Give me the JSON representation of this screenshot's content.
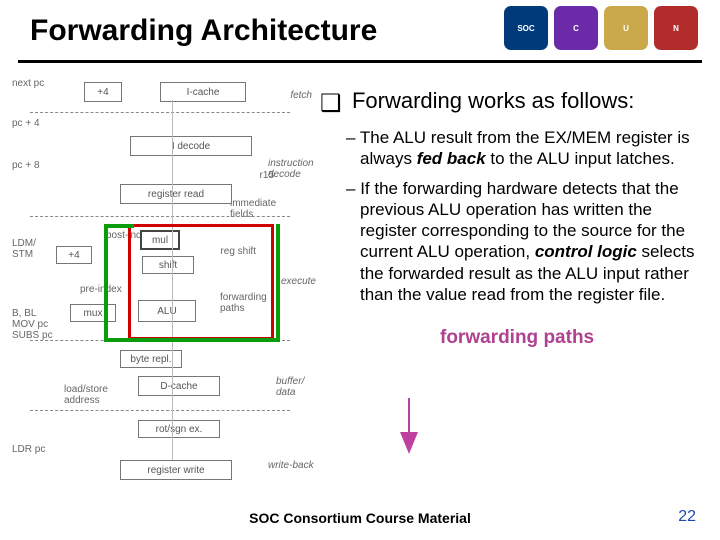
{
  "title": "Forwarding Architecture",
  "logos": [
    "SOC",
    "C",
    "U",
    "N"
  ],
  "lead": "Forwarding works as follows:",
  "bullets": [
    {
      "pre": "The ALU result from the EX/MEM register is always ",
      "em": "fed back",
      "post": " to the ALU input latches."
    },
    {
      "pre": "If the forwarding hardware detects that the previous ALU operation has written the register corresponding to the source for the current ALU operation, ",
      "em": "control logic",
      "post": " selects the forwarded result as the ALU input rather than the value read from the register file."
    }
  ],
  "fpaths_label": "forwarding paths",
  "footer": "SOC Consortium Course Material",
  "page": "22",
  "diag": {
    "fetch": "fetch",
    "decode": "instruction decode",
    "exec": "execute",
    "buf": "buffer/ data",
    "wb": "write-back",
    "next_pc": "next pc",
    "pc4": "pc + 4",
    "pc8": "pc + 8",
    "r15": "r15",
    "immed": "immediate fields",
    "plus4": "+4",
    "icache": "I-cache",
    "idec": "I decode",
    "regread": "register read",
    "mul": "mul",
    "shift": "shift",
    "regshift": "reg shift",
    "preidx": "pre-index",
    "postidx": "post-index",
    "plus4b": "+4",
    "mux": "mux",
    "alu": "ALU",
    "fwd": "forwarding paths",
    "ldm": "LDM/ STM",
    "bbl": "B, BL MOV pc SUBS pc",
    "byterep": "byte repl.",
    "dcache": "D-cache",
    "ldaddr": "load/store address",
    "rot": "rot/sgn ex.",
    "regwrite": "register write",
    "ldrpc": "LDR pc"
  }
}
